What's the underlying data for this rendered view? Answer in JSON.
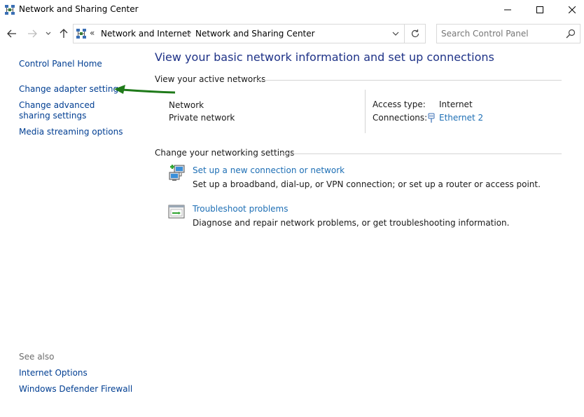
{
  "window": {
    "title": "Network and Sharing Center",
    "icon": "network-icon",
    "controls": [
      "minimize",
      "maximize",
      "close"
    ]
  },
  "address": {
    "overflow": "«",
    "breadcrumbs": [
      "Network and Internet",
      "Network and Sharing Center"
    ],
    "separator": "›"
  },
  "search": {
    "placeholder": "Search Control Panel",
    "value": ""
  },
  "sidebar": {
    "links": [
      "Control Panel Home",
      "Change adapter settings",
      "Change advanced sharing settings",
      "Media streaming options"
    ],
    "see_also_label": "See also",
    "see_also": [
      "Internet Options",
      "Windows Defender Firewall"
    ],
    "annotation_arrow_color": "#1f7a1a"
  },
  "main": {
    "title": "View your basic network information and set up connections",
    "active_networks": {
      "heading": "View your active networks",
      "network_name": "Network",
      "network_type": "Private network",
      "access_type_label": "Access type:",
      "access_type_value": "Internet",
      "connections_label": "Connections:",
      "connection_name": "Ethernet 2"
    },
    "settings": {
      "heading": "Change your networking settings",
      "items": [
        {
          "icon": "new-connection-icon",
          "title": "Set up a new connection or network",
          "description": "Set up a broadband, dial-up, or VPN connection; or set up a router or access point."
        },
        {
          "icon": "troubleshoot-icon",
          "title": "Troubleshoot problems",
          "description": "Diagnose and repair network problems, or get troubleshooting information."
        }
      ]
    }
  },
  "colors": {
    "link": "#1e6fb5",
    "sidebar_link": "#003e92",
    "title": "#1e3287"
  }
}
